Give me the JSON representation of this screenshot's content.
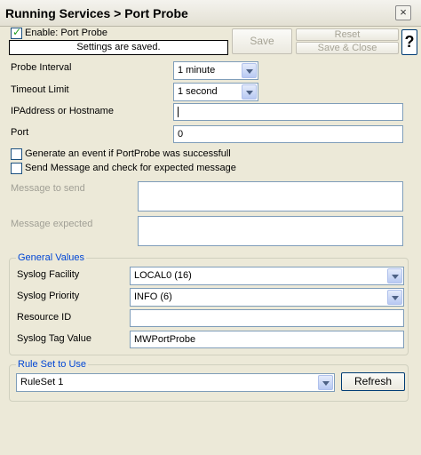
{
  "window": {
    "title": "Running Services > Port Probe",
    "close_glyph": "×"
  },
  "header": {
    "enable_label": "Enable: Port Probe",
    "enable_checked": true,
    "status_text": "Settings are saved.",
    "save_label": "Save",
    "reset_label": "Reset",
    "save_close_label": "Save & Close",
    "help_label": "?"
  },
  "form": {
    "probe_interval": {
      "label": "Probe Interval",
      "accel": "P",
      "value": "1 minute"
    },
    "timeout_limit": {
      "label": "Timeout Limit",
      "accel": "T",
      "value": "1 second"
    },
    "address": {
      "label": "IPAddress or Hostname",
      "accel": "I",
      "value": ""
    },
    "port": {
      "label": "Port",
      "accel": "o",
      "value": "0"
    },
    "generate_event": {
      "label": "Generate an event if PortProbe was successfull",
      "checked": false
    },
    "send_message": {
      "label": "Send Message and check for expected message",
      "checked": false
    },
    "message_to_send": {
      "label": "Message to send",
      "value": ""
    },
    "message_expected": {
      "label": "Message expected",
      "value": ""
    }
  },
  "general_values": {
    "title": "General Values",
    "syslog_facility": {
      "label": "Syslog Facility",
      "value": "LOCAL0 (16)"
    },
    "syslog_priority": {
      "label": "Syslog Priority",
      "value": "INFO (6)"
    },
    "resource_id": {
      "label": "Resource ID",
      "value": ""
    },
    "syslog_tag": {
      "label": "Syslog Tag Value",
      "value": "MWPortProbe"
    }
  },
  "rule_set": {
    "title": "Rule Set to Use",
    "value": "RuleSet 1",
    "refresh_label": "Refresh"
  },
  "colors": {
    "background": "#ece9d8",
    "group_title": "#0046d5",
    "disabled_text": "#a09f95",
    "input_border": "#7f9db9"
  }
}
